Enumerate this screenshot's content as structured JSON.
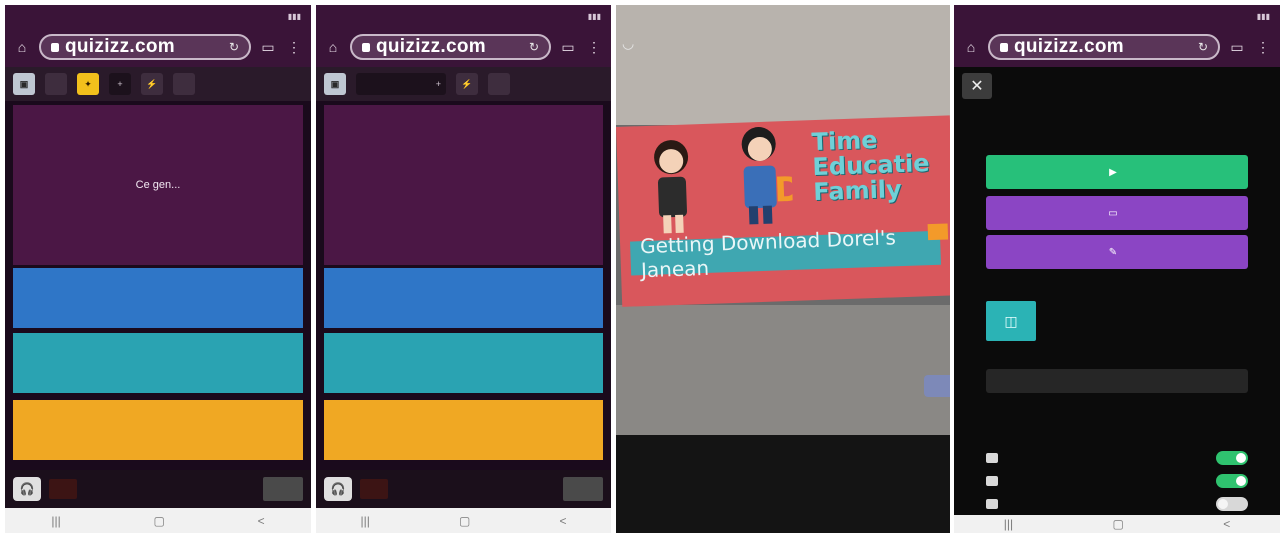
{
  "browser": {
    "status_time": "",
    "url": "quizizz.com",
    "home_glyph": "⌂",
    "tabs_glyph": "▭",
    "menu_glyph": "⋮",
    "refresh_glyph": "↻"
  },
  "toolbar": {
    "square_label": "▣",
    "plus_label": "+",
    "fifty_label": "",
    "timer_label": ""
  },
  "screen1": {
    "question": "Ce gen...",
    "answers": [
      "",
      "",
      ""
    ]
  },
  "screen2": {
    "question": "",
    "answers": [
      "",
      "",
      ""
    ]
  },
  "bottom_bar": {
    "avatar_glyph": "🎧",
    "hint_line1": "",
    "hint_line2": ""
  },
  "nav": {
    "recent": "|||",
    "home": "▢",
    "back": "<"
  },
  "photo": {
    "title": "Time Educatie Family",
    "banner": "Getting Download Dorel's Janean",
    "tag": "",
    "cam_glyph": "◡"
  },
  "menu": {
    "close_glyph": "✕",
    "continue_label": "",
    "play_glyph": "▶",
    "secondary_label": "",
    "tertiary_label": "",
    "quiz_name": "",
    "quiz_sub": "",
    "stat_players": "",
    "stat_plays": "",
    "report_label": "",
    "settings_head": "",
    "settings": [
      {
        "label": "",
        "on": true
      },
      {
        "label": "",
        "on": true
      },
      {
        "label": "",
        "on": false
      }
    ]
  },
  "colors": {
    "quiz_purple": "#4b1745",
    "answer_blue": "#2f76c7",
    "answer_teal": "#2aa3b2",
    "answer_orange": "#f0a823",
    "action_green": "#27c07a",
    "action_purple": "#8b45c4"
  }
}
